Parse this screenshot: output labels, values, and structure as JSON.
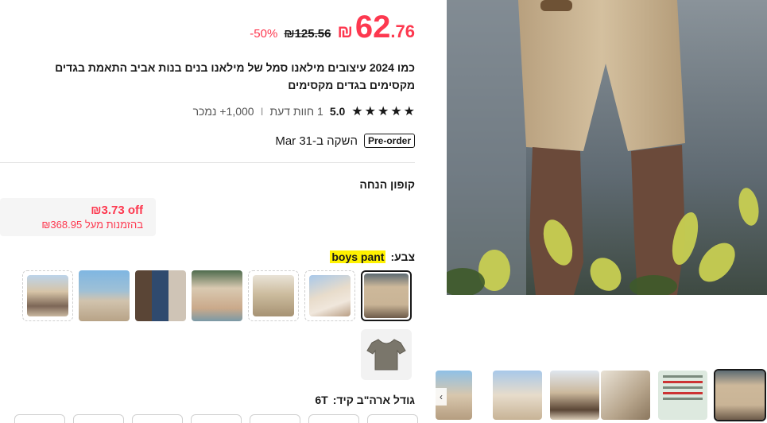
{
  "price": {
    "currency": "₪",
    "integer": "62",
    "decimal": ".76",
    "original": "₪125.56",
    "discount": "-50%"
  },
  "product": {
    "title": "כמו 2024 עיצובים מילאנו סמל של מילאנו בנים בנות אביב התאמת בגדים מקסימים בגדים מקסימים"
  },
  "rating": {
    "score": "5.0",
    "reviews": "1 חוות דעת",
    "separator": "I",
    "sold": "1,000+ נמכר"
  },
  "shipping": {
    "badge": "Pre-order",
    "text": "השקה ב-Mar 31"
  },
  "coupon": {
    "title": "קופון הנחה",
    "amount": "₪3.73 off",
    "condition": "בהזמנות מעל ₪368.95"
  },
  "color": {
    "label": "צבע:",
    "selected": "boys pant"
  },
  "size": {
    "label": "גודל ארה\"ב קיד:",
    "selected": "6T"
  },
  "colors": {
    "accent": "#fd384f",
    "highlight": "#fff200",
    "text": "#191919"
  },
  "icons": {
    "star": "star-icon",
    "prev": "chevron-left-icon"
  }
}
